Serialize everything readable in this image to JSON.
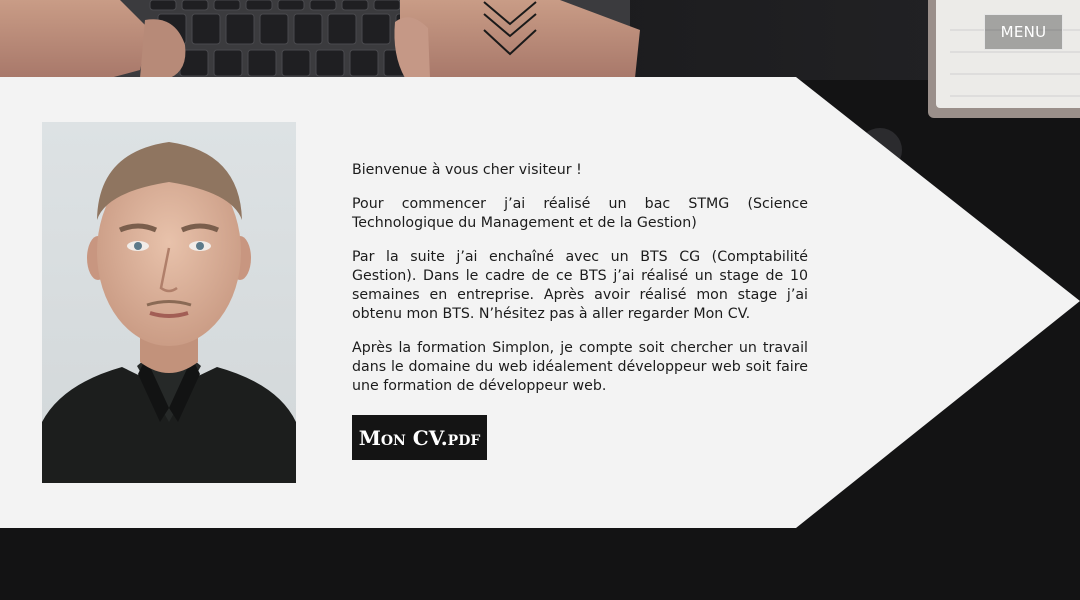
{
  "header": {
    "menu_label": "MENU"
  },
  "profile": {
    "photo_alt": "Photo de profil"
  },
  "intro": {
    "paragraphs": [
      "Bienvenue à vous cher visiteur !",
      "Pour commencer j’ai réalisé un bac STMG (Science Technologique du Management et de la Gestion)",
      "Par la suite j’ai enchaîné avec un BTS CG (Comptabilité Gestion). Dans le cadre de ce BTS j’ai réalisé un stage de 10 semaines en entreprise. Après avoir réalisé mon stage j’ai obtenu mon BTS. N’hésitez pas à aller regarder Mon CV.",
      "Après la formation Simplon, je compte soit chercher un travail dans le domaine du web idéalement développeur web soit faire une formation de développeur web."
    ]
  },
  "cv": {
    "button_label": "Mon CV.pdf"
  },
  "colors": {
    "panel": "#f3f3f3",
    "background": "#131314",
    "button": "#141414",
    "text": "#1c1c1c"
  },
  "icons": {
    "scroll": "chevron-down-icon"
  }
}
